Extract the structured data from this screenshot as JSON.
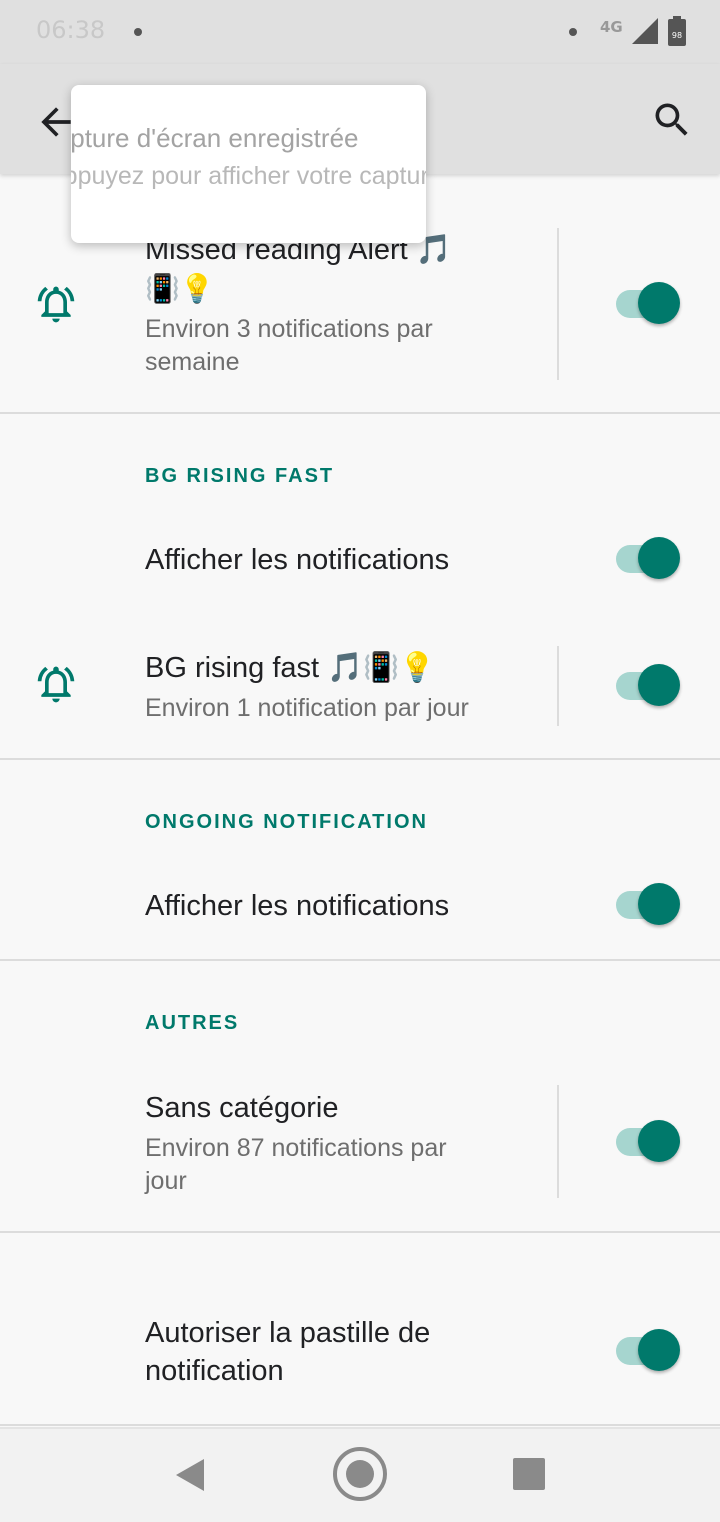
{
  "status_bar": {
    "time": "06:38",
    "network": "4G",
    "battery": "98"
  },
  "toast": {
    "title": "Capture d'écran enregistrée",
    "subtitle": "Appuyez pour afficher votre capture d'écran"
  },
  "channels": {
    "missed_reading": {
      "title": "Missed reading Alert 🎵",
      "title_line2": "📳💡",
      "subtitle": "Environ 3 notifications par",
      "subtitle_line2": "semaine"
    },
    "bg_rising_fast": {
      "header": "BG RISING FAST",
      "show_label": "Afficher les notifications",
      "title": "BG rising fast 🎵📳💡",
      "subtitle": "Environ 1 notification par jour"
    },
    "ongoing": {
      "header": "ONGOING NOTIFICATION",
      "show_label": "Afficher les notifications"
    },
    "autres": {
      "header": "AUTRES",
      "title": "Sans catégorie",
      "subtitle": "Environ 87 notifications par",
      "subtitle_line2": "jour"
    },
    "badge": {
      "title": "Autoriser la pastille de",
      "title_line2": "notification"
    }
  },
  "colors": {
    "accent": "#00796b",
    "track": "#a6d5cf"
  }
}
